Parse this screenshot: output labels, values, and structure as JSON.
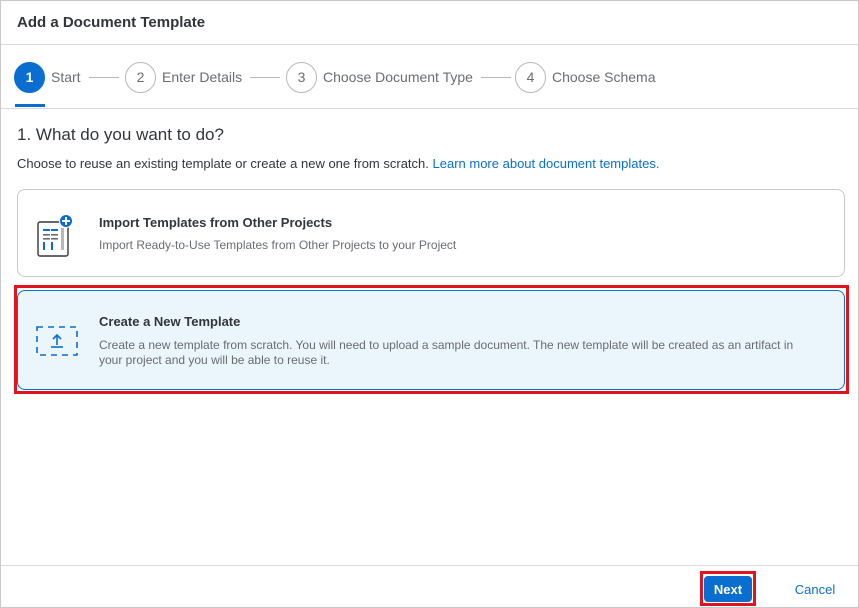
{
  "dialog": {
    "title": "Add a Document Template"
  },
  "wizard": {
    "steps": [
      {
        "number": "1",
        "label": "Start"
      },
      {
        "number": "2",
        "label": "Enter Details"
      },
      {
        "number": "3",
        "label": "Choose Document Type"
      },
      {
        "number": "4",
        "label": "Choose Schema"
      }
    ],
    "active_step": 1
  },
  "main": {
    "question": "1. What do you want to do?",
    "subtitle": "Choose to reuse an existing template or create a new one from scratch.",
    "learn_more_link": "Learn more about document templates."
  },
  "options": {
    "import": {
      "title": "Import Templates from Other Projects",
      "description": "Import Ready-to-Use Templates from Other Projects to your Project",
      "icon": "document-add-icon"
    },
    "create": {
      "title": "Create a New Template",
      "description": "Create a new template from scratch. You will need to upload a sample document. The new template will be created as an artifact in your project and you will be able to reuse it.",
      "icon": "upload-icon",
      "selected": true
    }
  },
  "footer": {
    "next_label": "Next",
    "cancel_label": "Cancel"
  },
  "colors": {
    "accent": "#0a6ed1",
    "highlight": "#e0141e",
    "selected_bg": "#eaf5fc"
  }
}
